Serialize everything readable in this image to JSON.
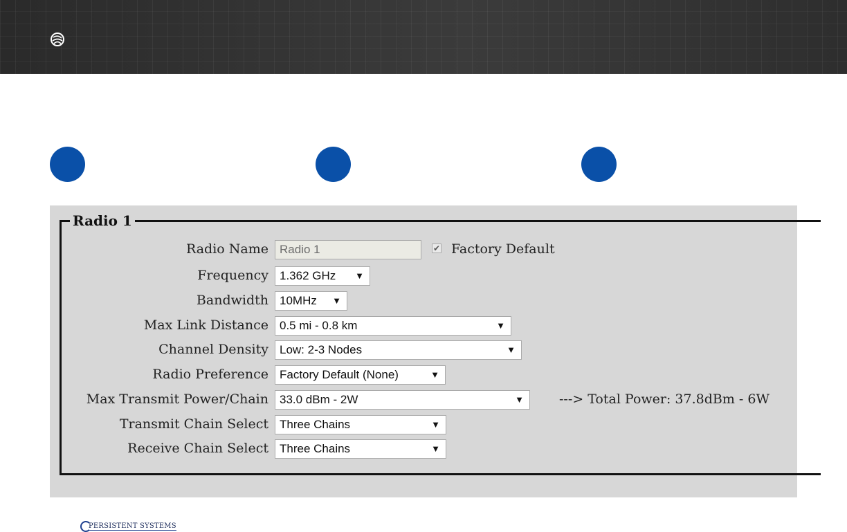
{
  "header": {
    "logo_icon": "persistent-systems-logo-icon"
  },
  "colors": {
    "header_bg": "#2e2e2e",
    "step_circle": "#0a50a8",
    "panel_bg": "#d7d7d7"
  },
  "form": {
    "legend": "Radio 1",
    "radio_name": {
      "label": "Radio Name",
      "value": "Radio 1"
    },
    "factory_default": {
      "label": "Factory Default",
      "checked": true
    },
    "frequency": {
      "label": "Frequency",
      "value": "1.362 GHz"
    },
    "bandwidth": {
      "label": "Bandwidth",
      "value": "10MHz"
    },
    "max_link_distance": {
      "label": "Max Link Distance",
      "value": "0.5 mi - 0.8 km"
    },
    "channel_density": {
      "label": "Channel Density",
      "value": "Low: 2-3 Nodes"
    },
    "radio_preference": {
      "label": "Radio Preference",
      "value": "Factory Default (None)"
    },
    "max_transmit_power": {
      "label": "Max Transmit Power/Chain",
      "value": "33.0 dBm - 2W",
      "total": "---> Total Power: 37.8dBm - 6W"
    },
    "transmit_chain": {
      "label": "Transmit Chain Select",
      "value": "Three Chains"
    },
    "receive_chain": {
      "label": "Receive Chain Select",
      "value": "Three Chains"
    }
  },
  "footer": {
    "brand": "PERSISTENT SYSTEMS"
  }
}
